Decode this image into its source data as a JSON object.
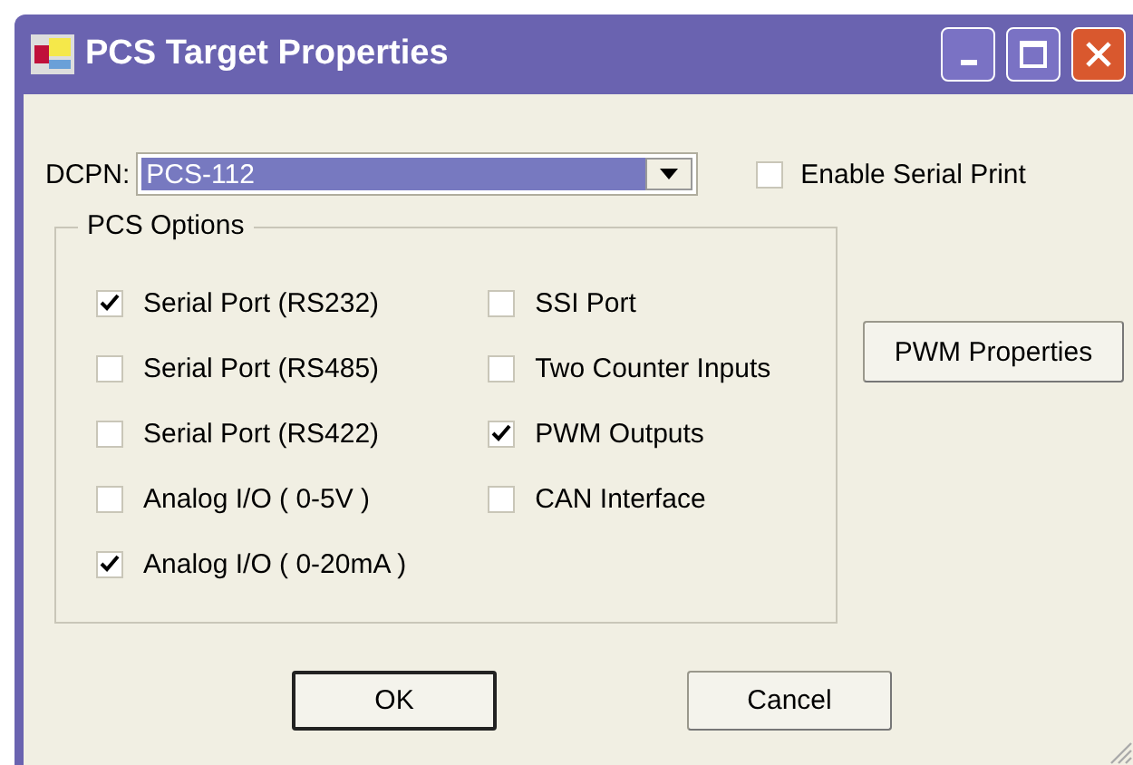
{
  "window": {
    "title": "PCS Target Properties"
  },
  "dcpn": {
    "label": "DCPN:",
    "value": "PCS-112"
  },
  "enable_serial_print": {
    "label": "Enable Serial Print",
    "checked": false
  },
  "pcs_options": {
    "title": "PCS Options",
    "columns": [
      [
        {
          "label": "Serial Port (RS232)",
          "checked": true
        },
        {
          "label": "Serial Port (RS485)",
          "checked": false
        },
        {
          "label": "Serial Port (RS422)",
          "checked": false
        },
        {
          "label": "Analog I/O ( 0-5V )",
          "checked": false
        },
        {
          "label": "Analog I/O ( 0-20mA )",
          "checked": true
        }
      ],
      [
        {
          "label": "SSI Port",
          "checked": false
        },
        {
          "label": "Two Counter Inputs",
          "checked": false
        },
        {
          "label": "PWM Outputs",
          "checked": true
        },
        {
          "label": "CAN Interface",
          "checked": false
        }
      ]
    ]
  },
  "pwm_button": "PWM Properties",
  "buttons": [
    "OK",
    "Cancel"
  ]
}
